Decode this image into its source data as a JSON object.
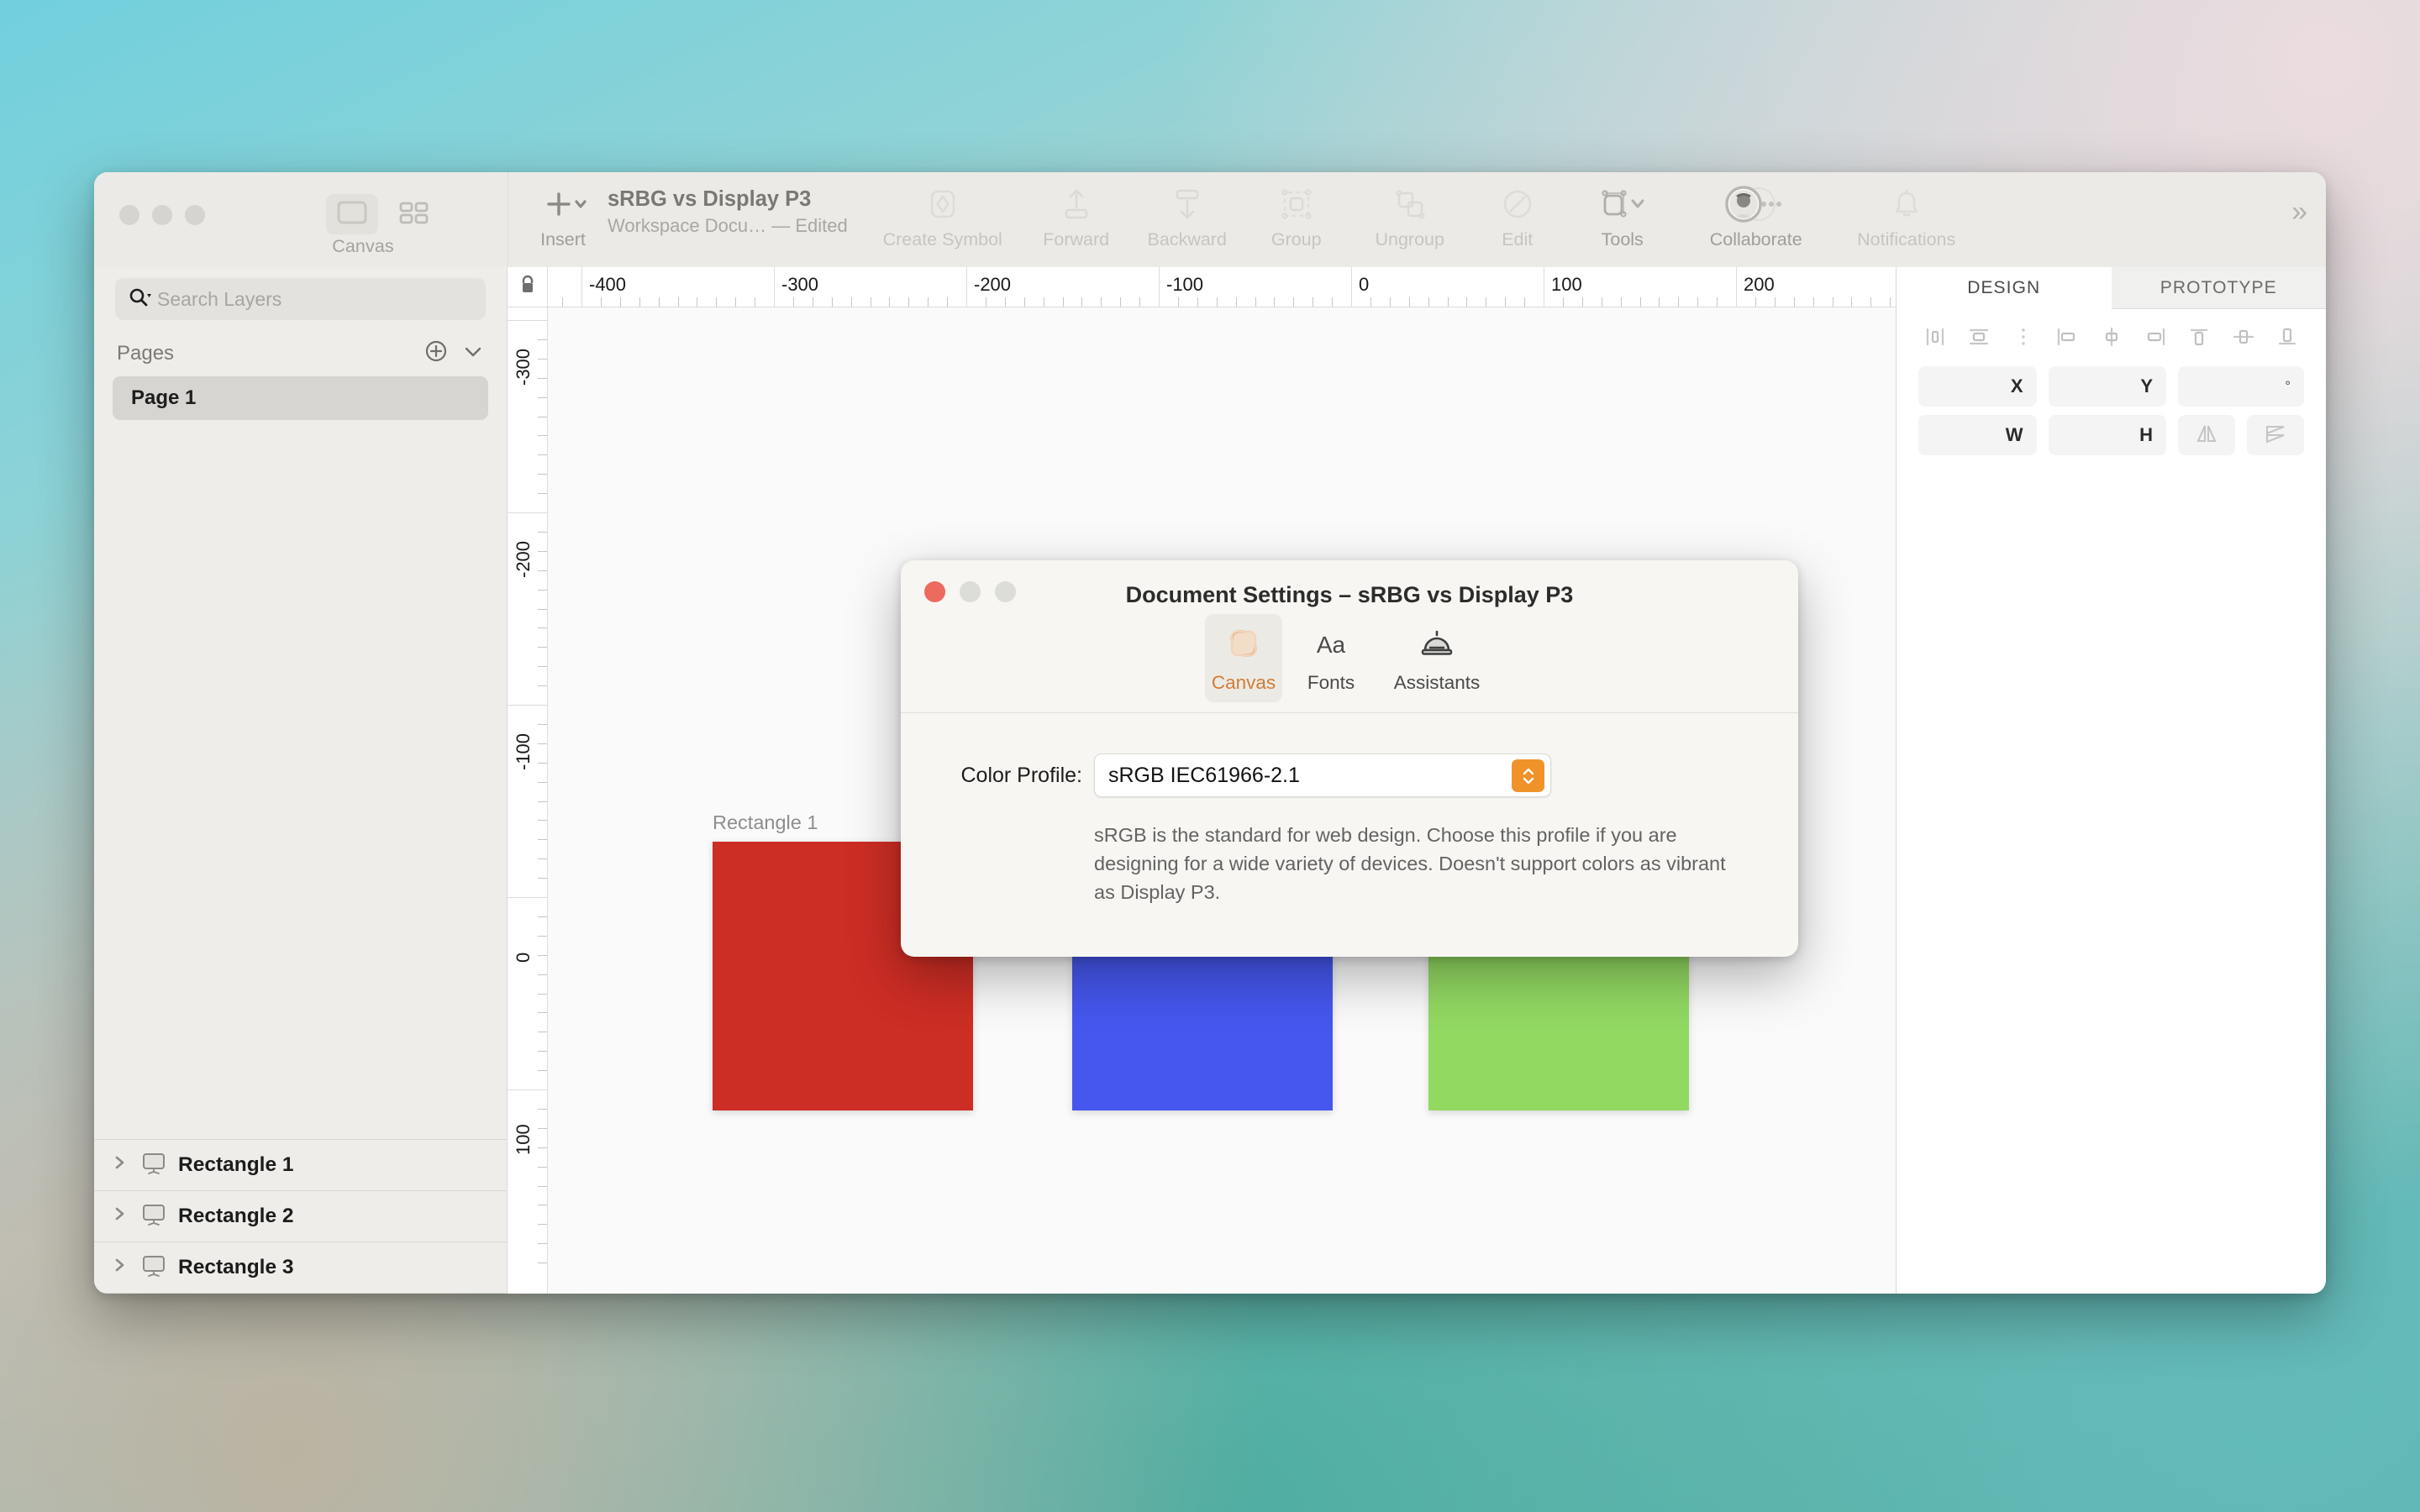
{
  "app": {
    "window_title": "sRBG vs Display P3",
    "document_subtitle": "Workspace Docu…  — Edited"
  },
  "toolbar": {
    "view_toggle_label": "Canvas",
    "canvas_icon": "artboard-icon",
    "grid_icon": "grid-view-icon",
    "items": [
      {
        "label": "Insert",
        "icon": "plus-icon",
        "state": "enabled"
      },
      {
        "label": "Create Symbol",
        "icon": "symbol-diamond-icon",
        "state": "disabled"
      },
      {
        "label": "Forward",
        "icon": "move-forward-icon",
        "state": "disabled"
      },
      {
        "label": "Backward",
        "icon": "move-backward-icon",
        "state": "disabled"
      },
      {
        "label": "Group",
        "icon": "group-icon",
        "state": "disabled"
      },
      {
        "label": "Ungroup",
        "icon": "ungroup-icon",
        "state": "disabled"
      },
      {
        "label": "Edit",
        "icon": "edit-path-icon",
        "state": "disabled"
      },
      {
        "label": "Tools",
        "icon": "tools-icon",
        "state": "enabled"
      },
      {
        "label": "Collaborate",
        "icon": "collaborate-avatar-icon",
        "state": "enabled"
      },
      {
        "label": "Notifications",
        "icon": "bell-icon",
        "state": "disabled"
      }
    ],
    "overflow_label": "»"
  },
  "sidebar": {
    "search": {
      "placeholder": "Search Layers",
      "value": ""
    },
    "pages_header": "Pages",
    "add_page_icon": "plus-circle-icon",
    "pages_menu_icon": "chevron-down-icon",
    "pages": [
      {
        "name": "Page 1",
        "selected": true
      }
    ],
    "layers": [
      {
        "name": "Rectangle 1",
        "icon": "artboard-layer-icon"
      },
      {
        "name": "Rectangle 2",
        "icon": "artboard-layer-icon"
      },
      {
        "name": "Rectangle 3",
        "icon": "artboard-layer-icon"
      }
    ]
  },
  "rulers": {
    "lock_icon": "lock-icon",
    "horizontal_labels": [
      "-400",
      "-300",
      "-200",
      "-100",
      "0",
      "100",
      "200"
    ],
    "vertical_labels": [
      "-300",
      "-200",
      "-100",
      "0",
      "100"
    ]
  },
  "canvas": {
    "artboards": [
      {
        "label": "Rectangle 1",
        "color": "#cc2d24"
      },
      {
        "label": "Rectangle 2",
        "color": "#4557ee"
      },
      {
        "label": "Rectangle 3",
        "color": "#92d962"
      }
    ]
  },
  "inspector": {
    "tabs": [
      {
        "label": "DESIGN",
        "active": true
      },
      {
        "label": "PROTOTYPE",
        "active": false
      }
    ],
    "align_icons": [
      "align-left-icon",
      "align-center-horizontal-icon",
      "distribute-icon",
      "align-edge-left-icon",
      "align-middle-icon",
      "align-edge-right-icon",
      "align-top-icon",
      "align-vertical-center-icon",
      "align-bottom-icon"
    ],
    "fields": {
      "x_label": "X",
      "x_value": "",
      "y_label": "Y",
      "y_value": "",
      "rotation_label": "°",
      "rotation_value": "",
      "w_label": "W",
      "w_value": "",
      "h_label": "H",
      "h_value": "",
      "flip_horizontal_icon": "flip-horizontal-icon",
      "flip_vertical_icon": "flip-vertical-icon"
    }
  },
  "dialog": {
    "title": "Document Settings – sRBG vs Display P3",
    "close_icon": "close-icon",
    "minimize_icon": "minimize-icon",
    "maximize_icon": "maximize-icon",
    "tabs": [
      {
        "label": "Canvas",
        "icon": "canvas-icon",
        "active": true
      },
      {
        "label": "Fonts",
        "icon": "fonts-aa-icon",
        "active": false
      },
      {
        "label": "Assistants",
        "icon": "assistants-bell-icon",
        "active": false
      }
    ],
    "color_profile_label": "Color Profile:",
    "color_profile_value": "sRGB IEC61966-2.1",
    "stepper_icon": "stepper-up-down-icon",
    "description": "sRGB is the standard for web design. Choose this profile if you are designing for a wide variety of devices. Doesn't support colors as vibrant as Display P3.",
    "accent_color": "#f0922a"
  }
}
